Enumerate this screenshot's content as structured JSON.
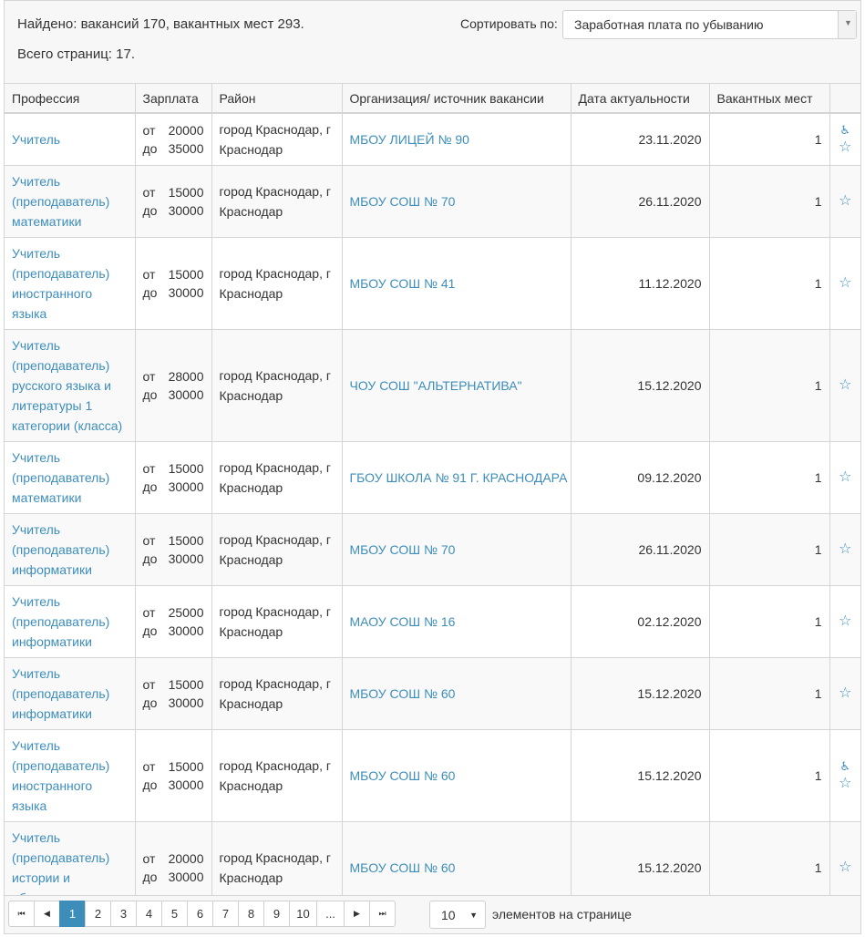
{
  "summary": {
    "found_text": "Найдено: вакансий 170, вакантных мест 293.",
    "pages_text": "Всего страниц: 17."
  },
  "sort": {
    "label": "Сортировать по:",
    "selected": "Заработная плата по убыванию"
  },
  "columns": {
    "profession": "Профессия",
    "salary": "Зарплата",
    "district": "Район",
    "organization": "Организация/ источник вакансии",
    "date": "Дата актуальности",
    "vacancies": "Вакантных мест"
  },
  "rows": [
    {
      "profession": "Учитель",
      "from_label": "от",
      "from": "20000",
      "to_label": "до",
      "to": "35000",
      "district": "город Краснодар, г Краснодар",
      "org": "МБОУ ЛИЦЕЙ № 90",
      "date": "23.11.2020",
      "count": "1",
      "accessible": true,
      "star": "☆"
    },
    {
      "profession": "Учитель (преподаватель) математики",
      "from_label": "от",
      "from": "15000",
      "to_label": "до",
      "to": "30000",
      "district": "город Краснодар, г Краснодар",
      "org": "МБОУ СОШ № 70",
      "date": "26.11.2020",
      "count": "1",
      "accessible": false,
      "star": "☆"
    },
    {
      "profession": "Учитель (преподаватель) иностранного языка",
      "from_label": "от",
      "from": "15000",
      "to_label": "до",
      "to": "30000",
      "district": "город Краснодар, г Краснодар",
      "org": "МБОУ СОШ № 41",
      "date": "11.12.2020",
      "count": "1",
      "accessible": false,
      "star": "☆"
    },
    {
      "profession": "Учитель (преподаватель) русского языка и литературы 1 категории (класса)",
      "from_label": "от",
      "from": "28000",
      "to_label": "до",
      "to": "30000",
      "district": "город Краснодар, г Краснодар",
      "org": "ЧОУ СОШ \"АЛЬТЕРНАТИВА\"",
      "date": "15.12.2020",
      "count": "1",
      "accessible": false,
      "star": "☆"
    },
    {
      "profession": "Учитель (преподаватель) математики",
      "from_label": "от",
      "from": "15000",
      "to_label": "до",
      "to": "30000",
      "district": "город Краснодар, г Краснодар",
      "org": "ГБОУ ШКОЛА № 91 Г. КРАСНОДАРА",
      "date": "09.12.2020",
      "count": "1",
      "accessible": false,
      "star": "☆"
    },
    {
      "profession": "Учитель (преподаватель) информатики",
      "from_label": "от",
      "from": "15000",
      "to_label": "до",
      "to": "30000",
      "district": "город Краснодар, г Краснодар",
      "org": "МБОУ СОШ № 70",
      "date": "26.11.2020",
      "count": "1",
      "accessible": false,
      "star": "☆"
    },
    {
      "profession": "Учитель (преподаватель) информатики",
      "from_label": "от",
      "from": "25000",
      "to_label": "до",
      "to": "30000",
      "district": "город Краснодар, г Краснодар",
      "org": "МАОУ СОШ № 16",
      "date": "02.12.2020",
      "count": "1",
      "accessible": false,
      "star": "☆"
    },
    {
      "profession": "Учитель (преподаватель) информатики",
      "from_label": "от",
      "from": "15000",
      "to_label": "до",
      "to": "30000",
      "district": "город Краснодар, г Краснодар",
      "org": "МБОУ СОШ № 60",
      "date": "15.12.2020",
      "count": "1",
      "accessible": false,
      "star": "☆"
    },
    {
      "profession": "Учитель (преподаватель) иностранного языка",
      "from_label": "от",
      "from": "15000",
      "to_label": "до",
      "to": "30000",
      "district": "город Краснодар, г Краснодар",
      "org": "МБОУ СОШ № 60",
      "date": "15.12.2020",
      "count": "1",
      "accessible": true,
      "star": "☆"
    },
    {
      "profession": "Учитель (преподаватель) истории и обществознания",
      "from_label": "от",
      "from": "20000",
      "to_label": "до",
      "to": "30000",
      "district": "город Краснодар, г Краснодар",
      "org": "МБОУ СОШ № 60",
      "date": "15.12.2020",
      "count": "1",
      "accessible": false,
      "star": "☆"
    }
  ],
  "icons": {
    "accessible": "wheelchair-icon",
    "favorite": "star-outline-icon",
    "first": "first-page-icon",
    "prev": "prev-page-icon",
    "next": "next-page-icon",
    "last": "last-page-icon",
    "dropdown": "chevron-down-icon"
  },
  "pager": {
    "first": "⏮",
    "prev": "◀",
    "pages": [
      "1",
      "2",
      "3",
      "4",
      "5",
      "6",
      "7",
      "8",
      "9",
      "10",
      "..."
    ],
    "active": "1",
    "next": "▶",
    "last": "⏭",
    "page_size": "10",
    "page_size_label": "элементов на странице"
  },
  "colors": {
    "link": "#3d8dbb",
    "header_bg": "#f7f7f7",
    "border": "#d5d5d5"
  }
}
